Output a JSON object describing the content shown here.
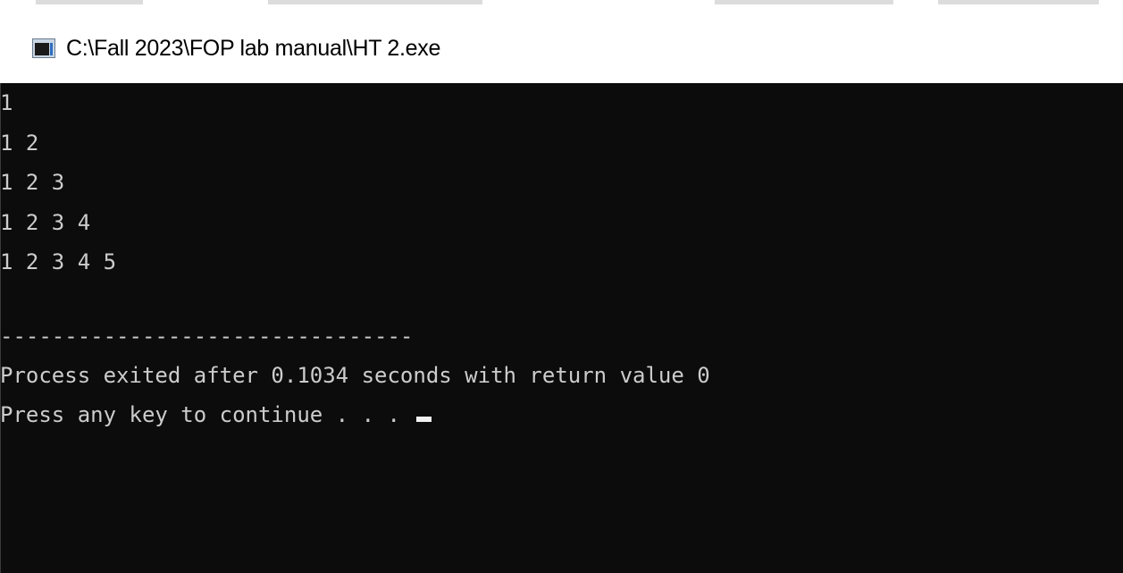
{
  "window": {
    "title": "C:\\Fall 2023\\FOP lab manual\\HT 2.exe",
    "icon": "console-app-icon"
  },
  "console": {
    "lines": [
      "1",
      "1 2",
      "1 2 3",
      "1 2 3 4",
      "1 2 3 4 5",
      "",
      "--------------------------------",
      "Process exited after 0.1034 seconds with return value 0",
      "Press any key to continue . . . "
    ],
    "cursor": "block-cursor",
    "colors": {
      "background": "#0c0c0c",
      "text": "#cccccc"
    }
  }
}
